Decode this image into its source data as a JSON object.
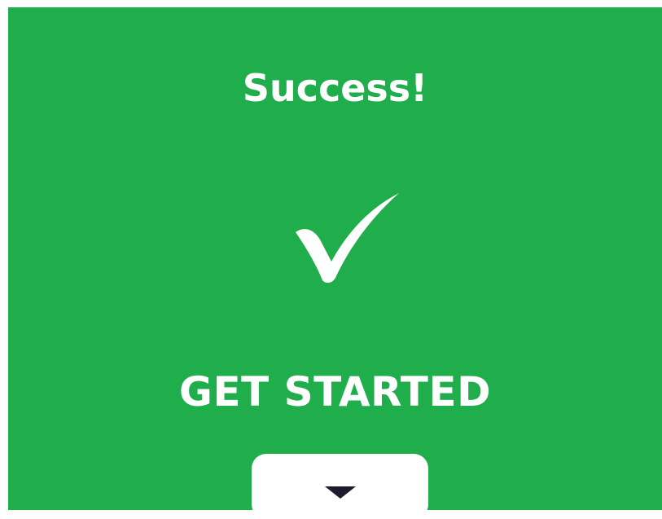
{
  "screen": {
    "title": "Success!",
    "cta_label": "GET STARTED",
    "background_color": "#1fae4b",
    "foreground_color": "#ffffff"
  },
  "icons": {
    "status": "checkmark-icon",
    "scroll": "caret-down-icon"
  }
}
